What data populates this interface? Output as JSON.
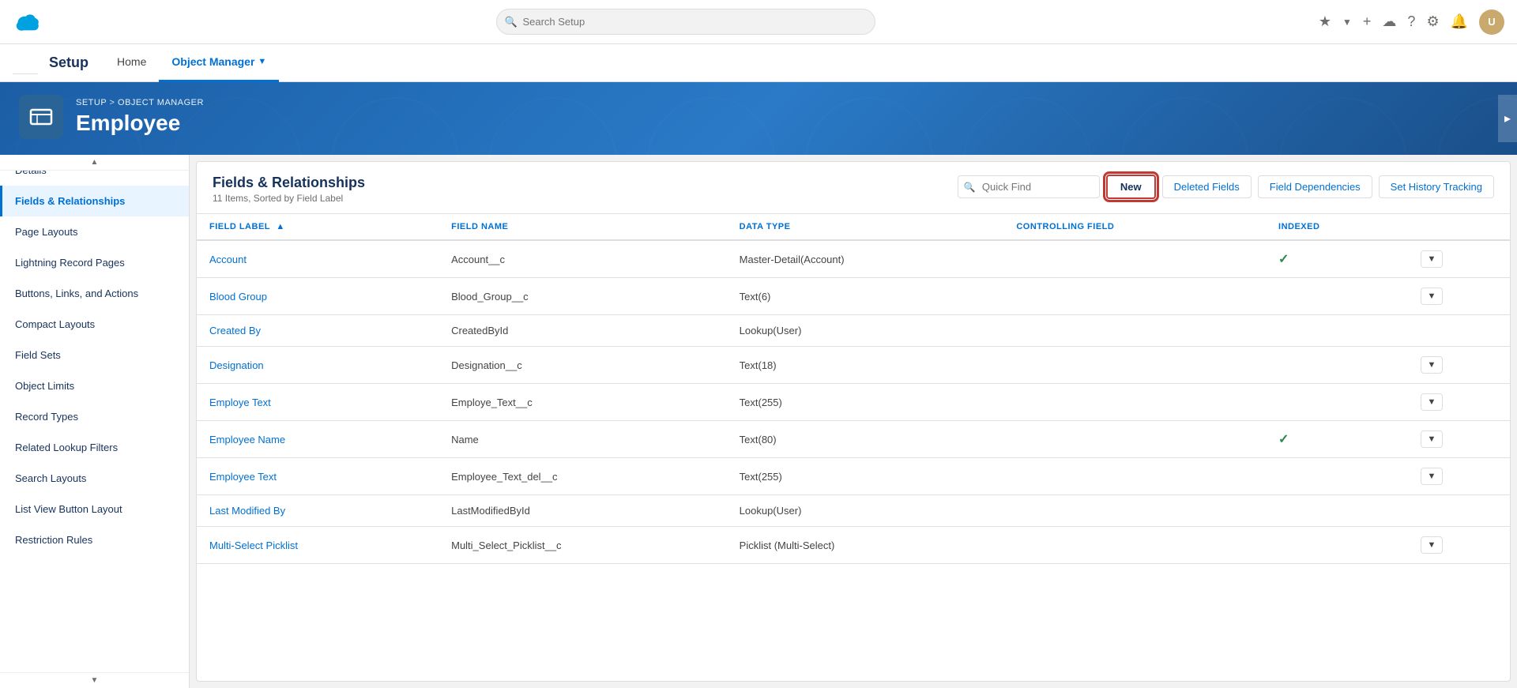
{
  "topNav": {
    "searchPlaceholder": "Search Setup",
    "appName": "Setup",
    "tabs": [
      {
        "label": "Home",
        "active": false
      },
      {
        "label": "Object Manager",
        "active": true,
        "hasArrow": true
      }
    ]
  },
  "banner": {
    "breadcrumb": [
      "SETUP",
      "OBJECT MANAGER"
    ],
    "breadcrumbSeparator": " > ",
    "title": "Employee"
  },
  "sidebar": {
    "items": [
      {
        "label": "Details",
        "active": false
      },
      {
        "label": "Fields & Relationships",
        "active": true
      },
      {
        "label": "Page Layouts",
        "active": false
      },
      {
        "label": "Lightning Record Pages",
        "active": false
      },
      {
        "label": "Buttons, Links, and Actions",
        "active": false
      },
      {
        "label": "Compact Layouts",
        "active": false
      },
      {
        "label": "Field Sets",
        "active": false
      },
      {
        "label": "Object Limits",
        "active": false
      },
      {
        "label": "Record Types",
        "active": false
      },
      {
        "label": "Related Lookup Filters",
        "active": false
      },
      {
        "label": "Search Layouts",
        "active": false
      },
      {
        "label": "List View Button Layout",
        "active": false
      },
      {
        "label": "Restriction Rules",
        "active": false
      }
    ]
  },
  "content": {
    "title": "Fields & Relationships",
    "subtitle": "11 Items, Sorted by Field Label",
    "quickFindPlaceholder": "Quick Find",
    "buttons": {
      "new": "New",
      "deletedFields": "Deleted Fields",
      "fieldDependencies": "Field Dependencies",
      "setHistoryTracking": "Set History Tracking"
    },
    "table": {
      "columns": [
        {
          "label": "FIELD LABEL",
          "sortable": true
        },
        {
          "label": "FIELD NAME",
          "sortable": false
        },
        {
          "label": "DATA TYPE",
          "sortable": false
        },
        {
          "label": "CONTROLLING FIELD",
          "sortable": false
        },
        {
          "label": "INDEXED",
          "sortable": false
        },
        {
          "label": "",
          "sortable": false
        }
      ],
      "rows": [
        {
          "fieldLabel": "Account",
          "fieldName": "Account__c",
          "dataType": "Master-Detail(Account)",
          "controllingField": "",
          "indexed": true,
          "hasDropdown": true
        },
        {
          "fieldLabel": "Blood Group",
          "fieldName": "Blood_Group__c",
          "dataType": "Text(6)",
          "controllingField": "",
          "indexed": false,
          "hasDropdown": true
        },
        {
          "fieldLabel": "Created By",
          "fieldName": "CreatedById",
          "dataType": "Lookup(User)",
          "controllingField": "",
          "indexed": false,
          "hasDropdown": false
        },
        {
          "fieldLabel": "Designation",
          "fieldName": "Designation__c",
          "dataType": "Text(18)",
          "controllingField": "",
          "indexed": false,
          "hasDropdown": true
        },
        {
          "fieldLabel": "Employe Text",
          "fieldName": "Employe_Text__c",
          "dataType": "Text(255)",
          "controllingField": "",
          "indexed": false,
          "hasDropdown": true
        },
        {
          "fieldLabel": "Employee Name",
          "fieldName": "Name",
          "dataType": "Text(80)",
          "controllingField": "",
          "indexed": true,
          "hasDropdown": true
        },
        {
          "fieldLabel": "Employee Text",
          "fieldName": "Employee_Text_del__c",
          "dataType": "Text(255)",
          "controllingField": "",
          "indexed": false,
          "hasDropdown": true
        },
        {
          "fieldLabel": "Last Modified By",
          "fieldName": "LastModifiedById",
          "dataType": "Lookup(User)",
          "controllingField": "",
          "indexed": false,
          "hasDropdown": false
        },
        {
          "fieldLabel": "Multi-Select Picklist",
          "fieldName": "Multi_Select_Picklist__c",
          "dataType": "Picklist (Multi-Select)",
          "controllingField": "",
          "indexed": false,
          "hasDropdown": true
        }
      ]
    }
  }
}
